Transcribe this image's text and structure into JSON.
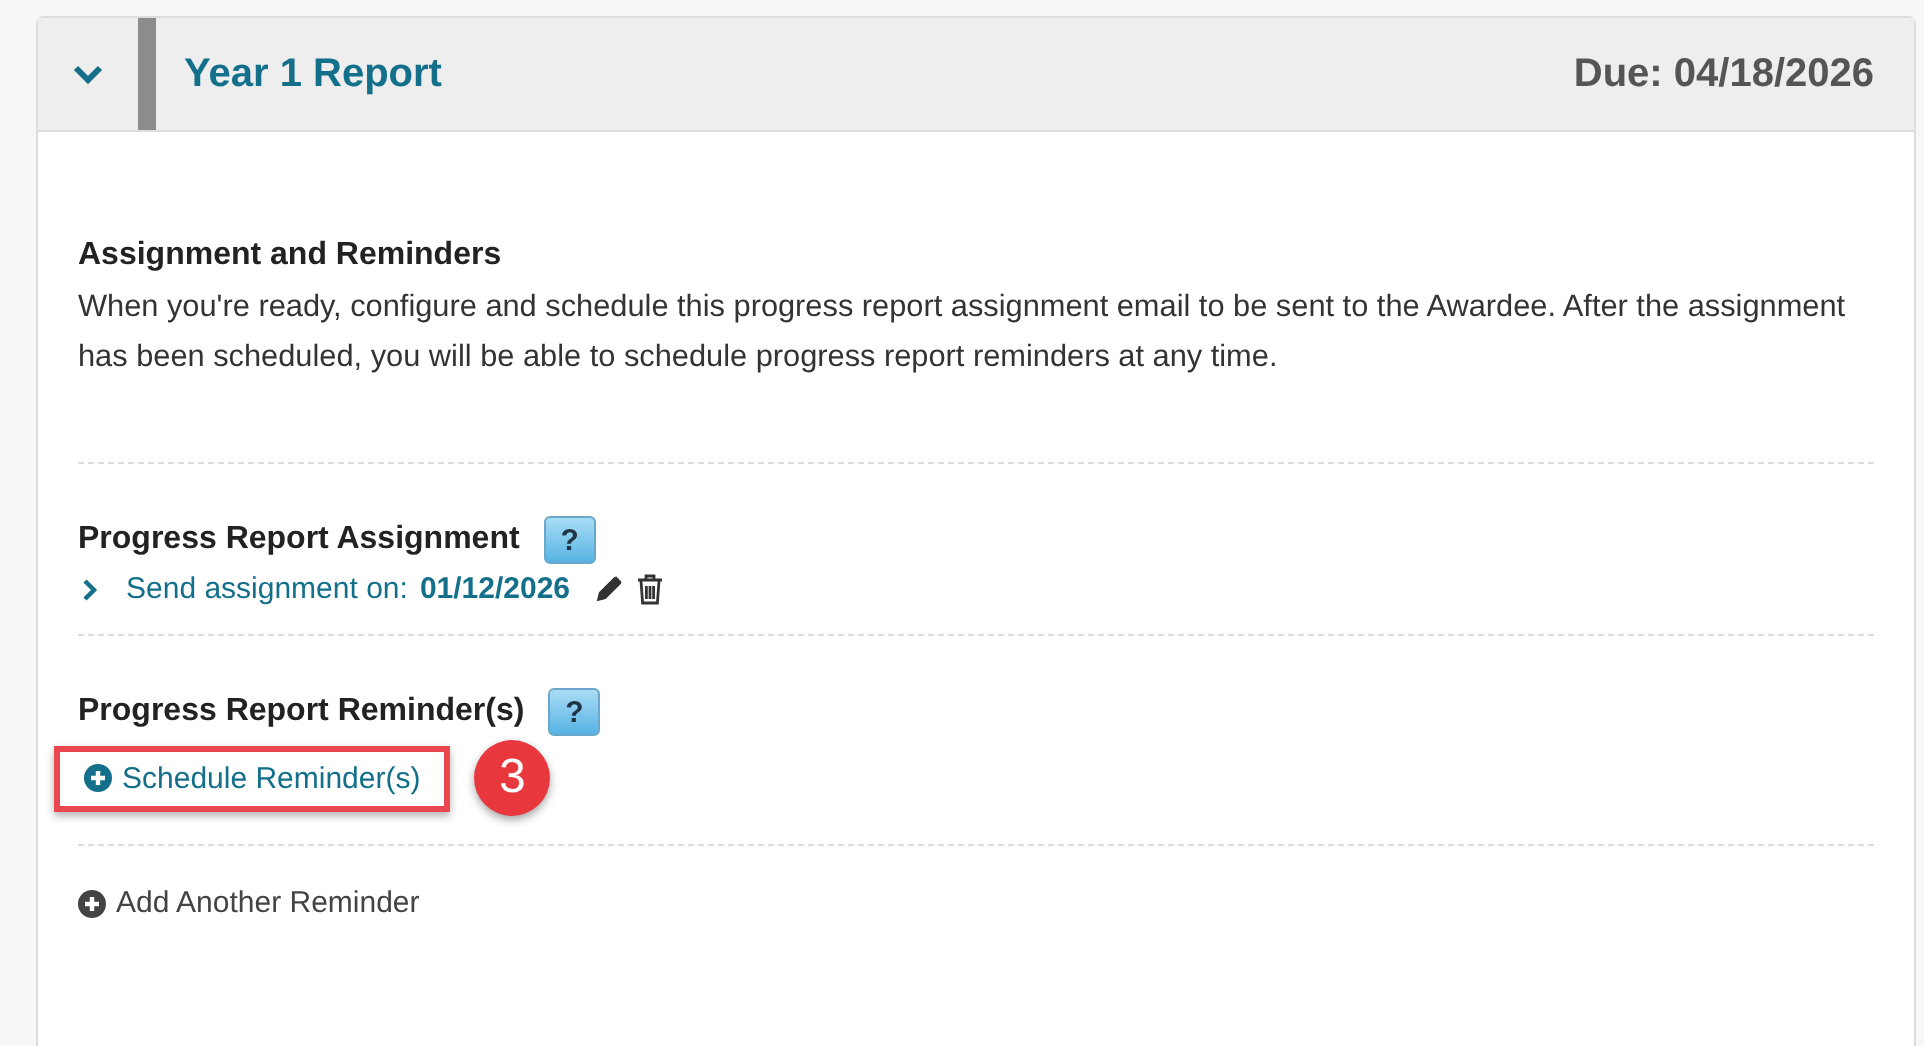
{
  "panel": {
    "expanded": true,
    "title": "Year 1 Report",
    "due": "Due: 04/18/2026"
  },
  "intro": {
    "heading": "Assignment and Reminders",
    "text": "When you're ready, configure and schedule this progress report assignment email to be sent to the Awardee. After the assignment has been scheduled, you will be able to schedule progress report reminders at any time."
  },
  "assignment": {
    "heading": "Progress Report Assignment",
    "help": "?",
    "expanded": false,
    "label": "Send assignment on:",
    "date": "01/12/2026"
  },
  "reminders": {
    "heading": "Progress Report Reminder(s)",
    "help": "?",
    "schedule_label": "Schedule Reminder(s)",
    "highlighted": true,
    "callout": "3"
  },
  "add_reminder": "Add Another Reminder"
}
